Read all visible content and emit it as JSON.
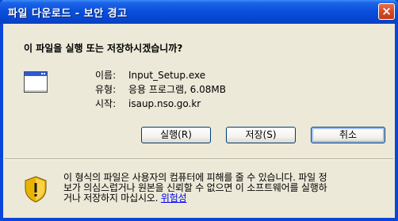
{
  "window": {
    "title": "파일 다운로드 - 보안 경고",
    "close_label": "×"
  },
  "prompt": {
    "question": "이 파일을 실행 또는 저장하시겠습니까?"
  },
  "file": {
    "name_label": "이름:",
    "name": "Input_Setup.exe",
    "type_label": "유형:",
    "type": "응용 프로그램, 6.08MB",
    "from_label": "시작:",
    "from": "isaup.nso.go.kr"
  },
  "buttons": {
    "run": "실행(R)",
    "save": "저장(S)",
    "cancel": "취소"
  },
  "warning": {
    "line1": "이 형식의 파일은 사용자의 컴퓨터에 피해를 줄 수 있습니다. 파일 정",
    "line2": "보가 의심스럽거나 원본을 신뢰할 수 없으면 이 소프트웨어를 실행하",
    "line3_prefix": "거나 저장하지 마십시오.",
    "risk_link": "위험성"
  }
}
